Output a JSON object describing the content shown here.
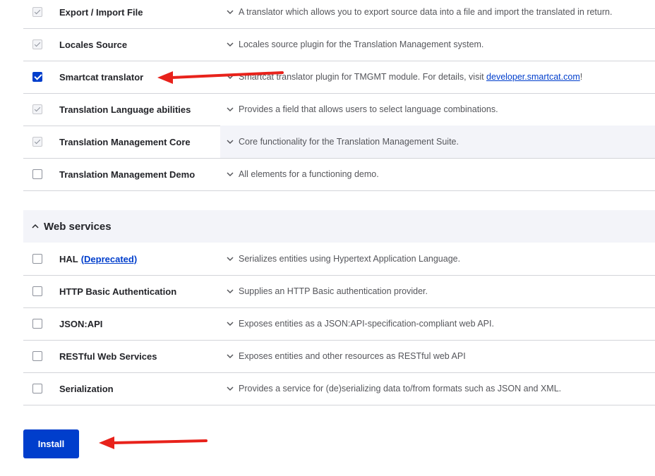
{
  "modules_top": [
    {
      "name": "Export / Import File",
      "state": "disabled-checked",
      "description": "A translator which allows you to export source data into a file and import the translated in return.",
      "highlight": false
    },
    {
      "name": "Locales Source",
      "state": "disabled-checked",
      "description": "Locales source plugin for the Translation Management system.",
      "highlight": false
    },
    {
      "name": "Smartcat translator",
      "state": "checked",
      "description_prefix": "Smartcat translator plugin for TMGMT module. For details, visit ",
      "link_text": "developer.smartcat.com",
      "description_suffix": "!",
      "highlight": false
    },
    {
      "name": "Translation Language abilities",
      "state": "disabled-checked",
      "description": "Provides a field that allows users to select language combinations.",
      "highlight": false
    },
    {
      "name": "Translation Management Core",
      "state": "disabled-checked",
      "description": "Core functionality for the Translation Management Suite.",
      "highlight": true
    },
    {
      "name": "Translation Management Demo",
      "state": "unchecked",
      "description": "All elements for a functioning demo.",
      "highlight": false
    }
  ],
  "section": {
    "title": "Web services",
    "icon": "chevron-up-icon"
  },
  "modules_web": [
    {
      "name": "HAL",
      "deprecated": "(Deprecated)",
      "state": "unchecked",
      "description": "Serializes entities using Hypertext Application Language."
    },
    {
      "name": "HTTP Basic Authentication",
      "state": "unchecked",
      "description": "Supplies an HTTP Basic authentication provider."
    },
    {
      "name": "JSON:API",
      "state": "unchecked",
      "description": "Exposes entities as a JSON:API-specification-compliant web API."
    },
    {
      "name": "RESTful Web Services",
      "state": "unchecked",
      "description": "Exposes entities and other resources as RESTful web API"
    },
    {
      "name": "Serialization",
      "state": "unchecked",
      "description": "Provides a service for (de)serializing data to/from formats such as JSON and XML."
    }
  ],
  "install_label": "Install",
  "colors": {
    "accent": "#003ecc",
    "annotation": "#e8221b",
    "section_bg": "#f3f4f9"
  }
}
